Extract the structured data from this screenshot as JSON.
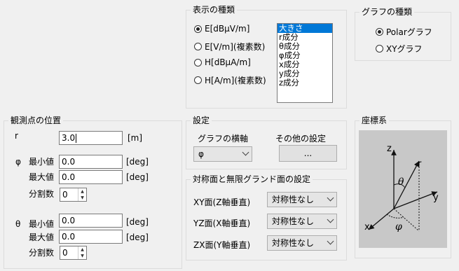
{
  "display_type": {
    "title": "表示の種類",
    "radios": [
      {
        "label": "E[dBμV/m]",
        "checked": true
      },
      {
        "label": "E[V/m](複素数)",
        "checked": false
      },
      {
        "label": "H[dBμA/m]",
        "checked": false
      },
      {
        "label": "H[A/m](複素数)",
        "checked": false
      }
    ],
    "list_items": [
      "大きさ",
      "r成分",
      "θ成分",
      "φ成分",
      "x成分",
      "y成分",
      "z成分"
    ],
    "selected_index": 0
  },
  "graph_type": {
    "title": "グラフの種類",
    "radios": [
      {
        "label": "Polarグラフ",
        "checked": true
      },
      {
        "label": "XYグラフ",
        "checked": false
      }
    ]
  },
  "observation": {
    "title": "観測点の位置",
    "r_label": "r",
    "r_value": "3.0",
    "r_unit": "[m]",
    "phi_symbol": "φ",
    "theta_symbol": "θ",
    "min_label": "最小値",
    "max_label": "最大値",
    "div_label": "分割数",
    "deg_unit": "[deg]",
    "phi_min": "0.0",
    "phi_max": "0.0",
    "phi_div": "0",
    "theta_min": "0.0",
    "theta_max": "0.0",
    "theta_div": "0"
  },
  "settings": {
    "title": "設定",
    "horizontal_axis_label": "グラフの横軸",
    "horizontal_axis_value": "φ",
    "other_settings_label": "その他の設定",
    "other_settings_button": "..."
  },
  "symmetry": {
    "title": "対称面と無限グランド面の設定",
    "rows": [
      {
        "label": "XY面(Z軸垂直)",
        "value": "対称性なし"
      },
      {
        "label": "YZ面(X軸垂直)",
        "value": "対称性なし"
      },
      {
        "label": "ZX面(Y軸垂直)",
        "value": "対称性なし"
      }
    ]
  },
  "coord_system": {
    "title": "座標系",
    "labels": {
      "z": "z",
      "y": "y",
      "x": "x",
      "r": "r",
      "theta": "θ",
      "phi": "φ"
    }
  },
  "colors": {
    "selection": "#0078d7",
    "coord_bg": "#c8c8c8"
  }
}
